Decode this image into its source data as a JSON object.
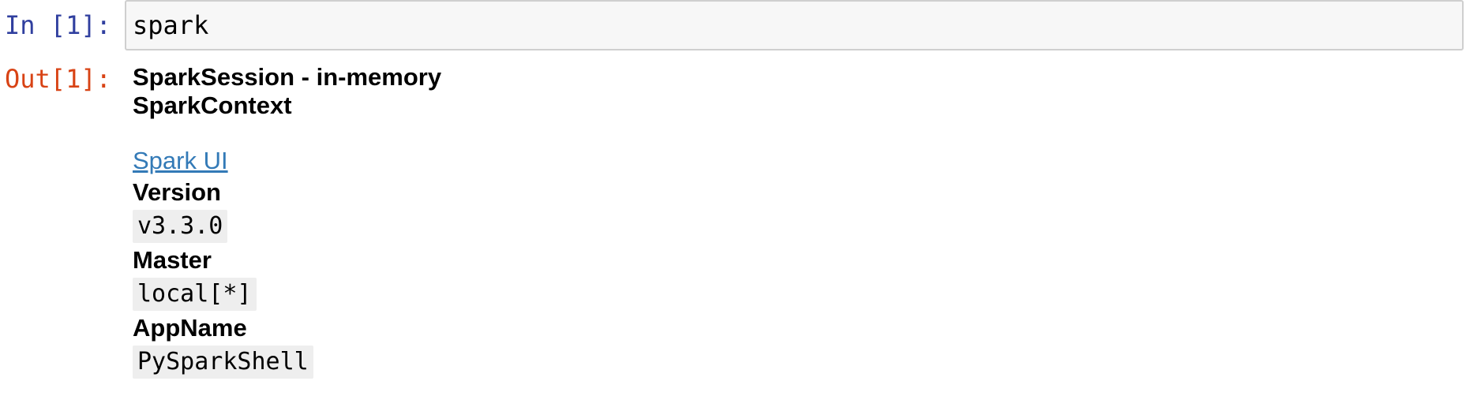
{
  "cell": {
    "in_prompt": "In [1]:",
    "input_code": "spark",
    "out_prompt": "Out[1]:"
  },
  "output": {
    "session_title": "SparkSession - in-memory",
    "context_title": "SparkContext",
    "ui_link_label": "Spark UI",
    "fields": [
      {
        "label": "Version",
        "value": "v3.3.0"
      },
      {
        "label": "Master",
        "value": "local[*]"
      },
      {
        "label": "AppName",
        "value": "PySparkShell"
      }
    ]
  },
  "colors": {
    "in_prompt": "#303f9f",
    "out_prompt": "#d84315",
    "link": "#337ab7",
    "code_bg": "#eeeeee",
    "input_bg": "#f7f7f7"
  }
}
